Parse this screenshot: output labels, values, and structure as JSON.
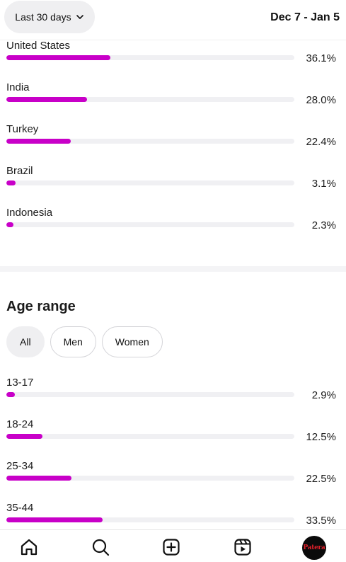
{
  "header": {
    "range_label": "Last 30 days",
    "date_range": "Dec 7 - Jan 5"
  },
  "countries": [
    {
      "label": "United States",
      "value": 36.1,
      "display": "36.1%"
    },
    {
      "label": "India",
      "value": 28.0,
      "display": "28.0%"
    },
    {
      "label": "Turkey",
      "value": 22.4,
      "display": "22.4%"
    },
    {
      "label": "Brazil",
      "value": 3.1,
      "display": "3.1%"
    },
    {
      "label": "Indonesia",
      "value": 2.3,
      "display": "2.3%"
    }
  ],
  "age_section": {
    "title": "Age range",
    "filters": [
      "All",
      "Men",
      "Women"
    ],
    "active_filter": "All",
    "rows": [
      {
        "label": "13-17",
        "value": 2.9,
        "display": "2.9%"
      },
      {
        "label": "18-24",
        "value": 12.5,
        "display": "12.5%"
      },
      {
        "label": "25-34",
        "value": 22.5,
        "display": "22.5%"
      },
      {
        "label": "35-44",
        "value": 33.5,
        "display": "33.5%"
      }
    ]
  },
  "bar_scale_max": 100,
  "colors": {
    "bar_fill": "#c800c8",
    "bar_track": "#f0f0f3",
    "chip_active_bg": "#efeff1"
  },
  "bottom_nav": {
    "items": [
      "home-icon",
      "search-icon",
      "create-icon",
      "reels-icon",
      "profile-avatar"
    ],
    "avatar_text": "Patera"
  }
}
